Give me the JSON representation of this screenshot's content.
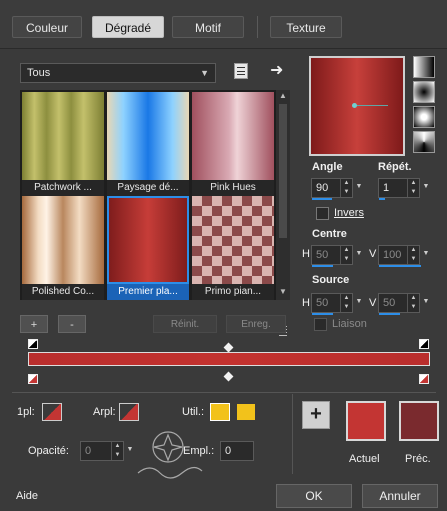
{
  "tabs": [
    {
      "label": "Couleur",
      "active": false
    },
    {
      "label": "Dégradé",
      "active": true
    },
    {
      "label": "Motif",
      "active": false
    },
    {
      "label": "Texture",
      "active": false
    }
  ],
  "category_dropdown": {
    "value": "Tous"
  },
  "gradients": [
    {
      "name": "Patchwork ...",
      "selected": false
    },
    {
      "name": "Paysage dé...",
      "selected": false
    },
    {
      "name": "Pink Hues",
      "selected": false
    },
    {
      "name": "Polished Co...",
      "selected": false
    },
    {
      "name": "Premier pla...",
      "selected": true
    },
    {
      "name": "Primo pian...",
      "selected": false
    }
  ],
  "list_buttons": {
    "add": "+",
    "remove": "-",
    "reset": "Réinit.",
    "save": "Enreg."
  },
  "settings": {
    "angle_label": "Angle",
    "angle_value": "90",
    "repeat_label": "Répét.",
    "repeat_value": "1",
    "invert_label": "Invers",
    "center_label": "Centre",
    "center_h_label": "H",
    "center_h_value": "50",
    "center_v_label": "V",
    "center_v_value": "100",
    "source_label": "Source",
    "source_h_label": "H",
    "source_h_value": "50",
    "source_v_label": "V",
    "source_v_value": "50",
    "link_label": "Liaison"
  },
  "stops": {
    "first_label": "1pl:",
    "back_label": "Arpl:",
    "user_label": "Util.:",
    "opacity_label": "Opacité:",
    "opacity_value": "0",
    "location_label": "Empl.:",
    "location_value": "0"
  },
  "colors": {
    "current_label": "Actuel",
    "previous_label": "Préc.",
    "current": "#c33533",
    "previous": "#7a2a2e",
    "user_yellow": "#f2c21b",
    "accent": "#2d8ee8"
  },
  "footer": {
    "help": "Aide",
    "ok": "OK",
    "cancel": "Annuler"
  }
}
